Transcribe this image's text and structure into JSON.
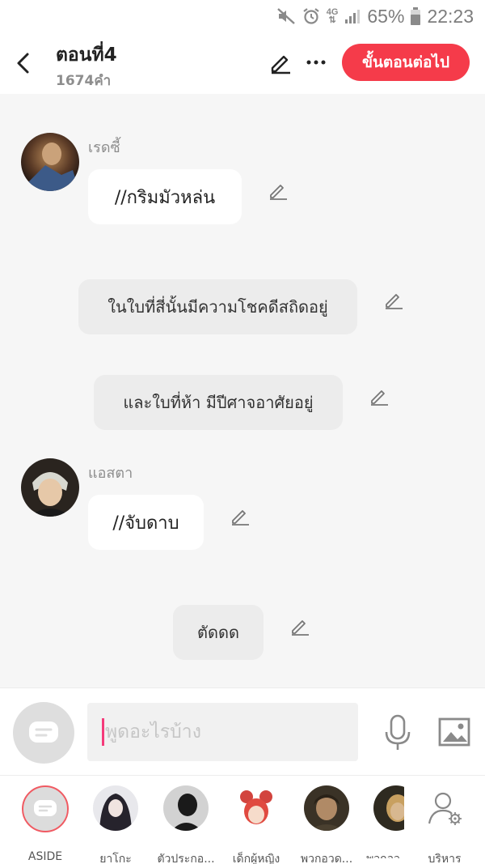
{
  "status": {
    "battery_pct": "65%",
    "time": "22:23",
    "network": "4G"
  },
  "header": {
    "title": "ตอนที่4",
    "word_count": "1674คำ",
    "next_label": "ขั้นตอนต่อไป"
  },
  "messages": [
    {
      "type": "character",
      "speaker": "เรดซี้",
      "text": "//กริมมัวหล่น"
    },
    {
      "type": "narration",
      "text": "ในใบที่สี่นั้นมีความโชคดีสถิดอยู่"
    },
    {
      "type": "narration",
      "text": "และใบที่ห้า มีปีศาจอาศัยอยู่"
    },
    {
      "type": "character",
      "speaker": "แอสตา",
      "text": "//จับดาบ"
    },
    {
      "type": "narration",
      "text": "ตัดดด"
    }
  ],
  "input": {
    "placeholder": "พูดอะไรบ้าง"
  },
  "characters": [
    {
      "name": "ASIDE"
    },
    {
      "name": "ยาโกะ"
    },
    {
      "name": "ตัวประกอ..."
    },
    {
      "name": "เด็กผู้หญิง"
    },
    {
      "name": "พวกอวด..."
    },
    {
      "name": "พวกอว"
    },
    {
      "name": "บริหาร"
    }
  ],
  "colors": {
    "accent": "#f53b4a",
    "caret": "#f53b7a"
  }
}
